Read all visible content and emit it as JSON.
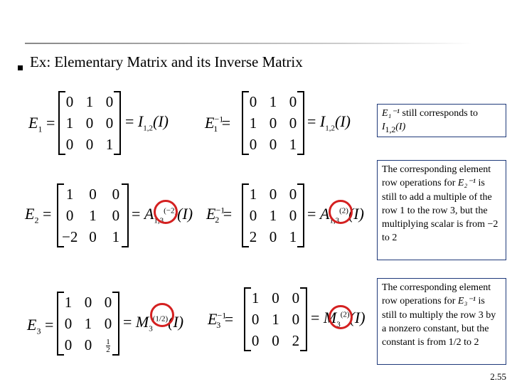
{
  "title": "Ex: Elementary Matrix and its Inverse Matrix",
  "equations": [
    {
      "lhs": "E",
      "lhs_sub": "1",
      "matrix": [
        [
          "0",
          "1",
          "0"
        ],
        [
          "1",
          "0",
          "0"
        ],
        [
          "0",
          "0",
          "1"
        ]
      ],
      "rhs_op": "I",
      "rhs_sub": "1,2",
      "rhs_sup": "",
      "rhs_arg": "(I)"
    },
    {
      "lhs": "E",
      "lhs_sub": "1",
      "lhs_sup": "−1",
      "matrix": [
        [
          "0",
          "1",
          "0"
        ],
        [
          "1",
          "0",
          "0"
        ],
        [
          "0",
          "0",
          "1"
        ]
      ],
      "rhs_op": "I",
      "rhs_sub": "1,2",
      "rhs_sup": "",
      "rhs_arg": "(I)"
    },
    {
      "lhs": "E",
      "lhs_sub": "2",
      "matrix": [
        [
          "1",
          "0",
          "0"
        ],
        [
          "0",
          "1",
          "0"
        ],
        [
          "−2",
          "0",
          "1"
        ]
      ],
      "rhs_op": "A",
      "rhs_sub": "1,3",
      "rhs_sup": "(−2)",
      "rhs_arg": "(I)"
    },
    {
      "lhs": "E",
      "lhs_sub": "2",
      "lhs_sup": "−1",
      "matrix": [
        [
          "1",
          "0",
          "0"
        ],
        [
          "0",
          "1",
          "0"
        ],
        [
          "2",
          "0",
          "1"
        ]
      ],
      "rhs_op": "A",
      "rhs_sub": "1,3",
      "rhs_sup": "(2)",
      "rhs_arg": "(I)"
    },
    {
      "lhs": "E",
      "lhs_sub": "3",
      "matrix": [
        [
          "1",
          "0",
          "0"
        ],
        [
          "0",
          "1",
          "0"
        ],
        [
          "0",
          "0",
          "1/2"
        ]
      ],
      "rhs_op": "M",
      "rhs_sub": "3",
      "rhs_sup": "(1/2)",
      "rhs_arg": "(I)"
    },
    {
      "lhs": "E",
      "lhs_sub": "3",
      "lhs_sup": "−1",
      "matrix": [
        [
          "1",
          "0",
          "0"
        ],
        [
          "0",
          "1",
          "0"
        ],
        [
          "0",
          "0",
          "2"
        ]
      ],
      "rhs_op": "M",
      "rhs_sub": "3",
      "rhs_sup": "(2)",
      "rhs_arg": "(I)"
    }
  ],
  "notes": {
    "n1_a": "E₁⁻¹",
    "n1_b": " still corresponds to ",
    "n1_c": "I",
    "n1_d": "1,2",
    "n1_e": "(I)",
    "n2_a": "The corresponding element row operations for ",
    "n2_b": "E₂⁻¹",
    "n2_c": " is still to add a multiple of the row 1 to the row 3, but the multiplying scalar is from −2 to 2",
    "n3_a": "The corresponding element row operations for ",
    "n3_b": "E₃⁻¹",
    "n3_c": " is still to multiply the row 3 by a nonzero constant, but the constant is from 1/2 to 2"
  },
  "highlight_color": "#d42020",
  "border_color": "#1f3a7a",
  "page_number": "2.55"
}
